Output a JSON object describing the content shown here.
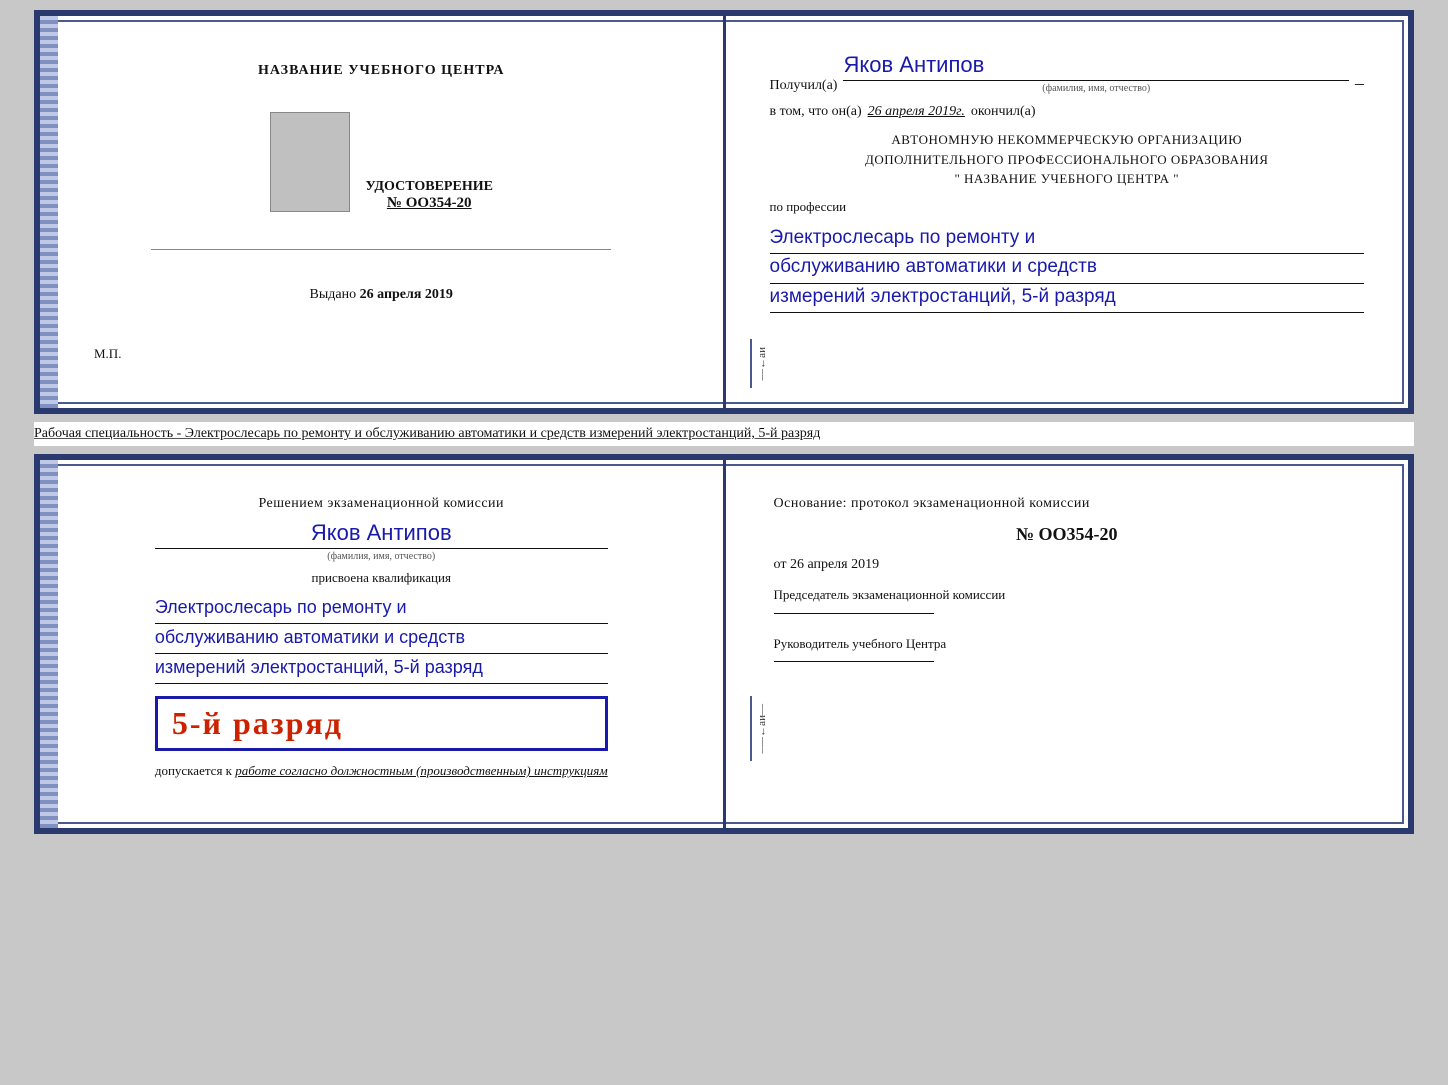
{
  "top_diploma": {
    "left": {
      "center_title": "НАЗВАНИЕ УЧЕБНОГО ЦЕНТРА",
      "cert_label": "УДОСТОВЕРЕНИЕ",
      "cert_number": "№ OO354-20",
      "issued_label": "Выдано",
      "issued_date": "26 апреля 2019",
      "mp_label": "М.П."
    },
    "right": {
      "recipient_prefix": "Получил(а)",
      "recipient_name": "Яков Антипов",
      "fio_sublabel": "(фамилия, имя, отчество)",
      "confirm_prefix": "в том, что он(а)",
      "confirm_date": "26 апреля 2019г.",
      "confirm_suffix": "окончил(а)",
      "org_line1": "АВТОНОМНУЮ НЕКОММЕРЧЕСКУЮ ОРГАНИЗАЦИЮ",
      "org_line2": "ДОПОЛНИТЕЛЬНОГО ПРОФЕССИОНАЛЬНОГО ОБРАЗОВАНИЯ",
      "org_name_prefix": "\"",
      "org_name": "НАЗВАНИЕ УЧЕБНОГО ЦЕНТРА",
      "org_name_suffix": "\"",
      "profession_label": "по профессии",
      "profession_text_line1": "Электрослесарь по ремонту и",
      "profession_text_line2": "обслуживанию автоматики и средств",
      "profession_text_line3": "измерений электростанций, 5-й разряд"
    }
  },
  "separator": {
    "text": "Рабочая специальность - Электрослесарь по ремонту и обслуживанию автоматики и средств измерений электростанций, 5-й разряд"
  },
  "bottom_diploma": {
    "left": {
      "decision_text": "Решением экзаменационной комиссии",
      "person_name": "Яков Антипов",
      "fio_sublabel": "(фамилия, имя, отчество)",
      "assigned_label": "присвоена квалификация",
      "qual_line1": "Электрослесарь по ремонту и",
      "qual_line2": "обслуживанию автоматики и средств",
      "qual_line3": "измерений электростанций, 5-й разряд",
      "rank_badge": "5-й разряд",
      "allowed_prefix": "допускается к",
      "allowed_italic": "работе согласно должностным (производственным) инструкциям"
    },
    "right": {
      "basis_title": "Основание: протокол экзаменационной комиссии",
      "protocol_num": "№ OO354-20",
      "protocol_date_prefix": "от",
      "protocol_date": "26 апреля 2019",
      "chairman_title": "Председатель экзаменационной комиссии",
      "director_title": "Руководитель учебного Центра"
    }
  },
  "margin_chars": [
    "и",
    "а",
    "←",
    "–",
    "–",
    "–"
  ]
}
